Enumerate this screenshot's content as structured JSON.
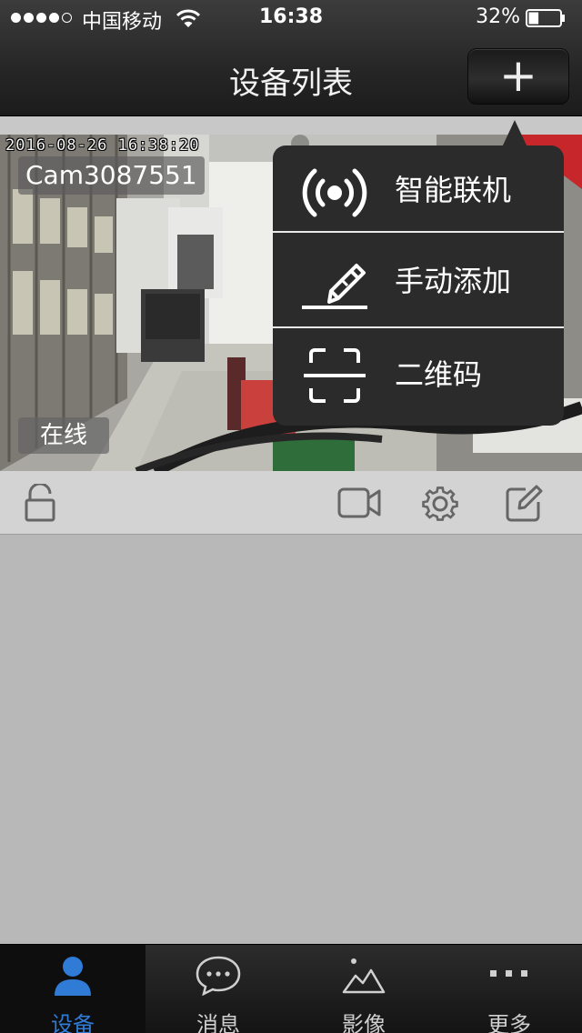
{
  "status_bar": {
    "signal_bars": 5,
    "signal_filled": 4,
    "carrier": "中国移动",
    "time": "16:38",
    "battery_percent": "32%",
    "battery_level": 0.32
  },
  "nav": {
    "title": "设备列表",
    "add_button_label": "+"
  },
  "device_card": {
    "camera_name": "Cam3087551",
    "osd_timestamp": "2016-08-26  16:38:20",
    "status_badge": "在线",
    "toolbar_icons": [
      "lock-open-icon",
      "video-record-icon",
      "gear-icon",
      "edit-icon"
    ]
  },
  "add_menu": {
    "items": [
      {
        "icon": "wireless-broadcast-icon",
        "label": "智能联机"
      },
      {
        "icon": "manual-pen-icon",
        "label": "手动添加"
      },
      {
        "icon": "qr-scan-icon",
        "label": "二维码"
      }
    ]
  },
  "tab_bar": {
    "tabs": [
      {
        "icon": "user-icon",
        "label": "设备",
        "active": true
      },
      {
        "icon": "chat-bubble-icon",
        "label": "消息",
        "active": false
      },
      {
        "icon": "landscape-image-icon",
        "label": "影像",
        "active": false
      },
      {
        "icon": "more-dots-icon",
        "label": "更多",
        "active": false
      }
    ]
  },
  "colors": {
    "accent_blue": "#2f7bd6",
    "header_bg": "#262626",
    "popup_bg": "#2b2b2b",
    "content_bg": "#b8b8b8"
  }
}
